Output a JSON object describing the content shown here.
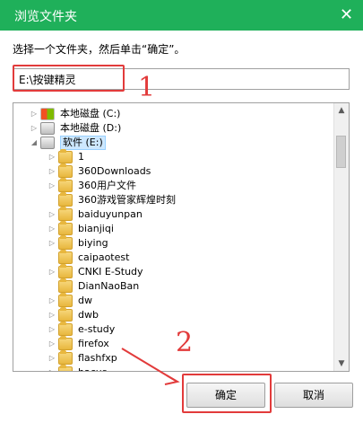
{
  "dialog": {
    "title": "浏览文件夹",
    "close_label": "✕"
  },
  "prompt": "选择一个文件夹，然后单击“确定”。",
  "path_input": {
    "value": "E:\\按键精灵"
  },
  "tree": {
    "items": [
      {
        "label": "本地磁盘 (C:)",
        "type": "drive-windows",
        "level": 0,
        "expand": "▷"
      },
      {
        "label": "本地磁盘 (D:)",
        "type": "drive",
        "level": 0,
        "expand": "▷"
      },
      {
        "label": "软件 (E:)",
        "type": "drive",
        "level": 0,
        "expand": "◢"
      },
      {
        "label": "1",
        "type": "folder",
        "level": 1,
        "expand": "▷"
      },
      {
        "label": "360Downloads",
        "type": "folder",
        "level": 1,
        "expand": "▷"
      },
      {
        "label": "360用户文件",
        "type": "folder",
        "level": 1,
        "expand": "▷"
      },
      {
        "label": "360游戏管家辉煌时刻",
        "type": "folder",
        "level": 1,
        "expand": ""
      },
      {
        "label": "baiduyunpan",
        "type": "folder",
        "level": 1,
        "expand": "▷"
      },
      {
        "label": "bianjiqi",
        "type": "folder",
        "level": 1,
        "expand": "▷"
      },
      {
        "label": "biying",
        "type": "folder",
        "level": 1,
        "expand": "▷"
      },
      {
        "label": "caipaotest",
        "type": "folder",
        "level": 1,
        "expand": ""
      },
      {
        "label": "CNKI E-Study",
        "type": "folder",
        "level": 1,
        "expand": "▷"
      },
      {
        "label": "DianNaoBan",
        "type": "folder",
        "level": 1,
        "expand": ""
      },
      {
        "label": "dw",
        "type": "folder",
        "level": 1,
        "expand": "▷"
      },
      {
        "label": "dwb",
        "type": "folder",
        "level": 1,
        "expand": "▷"
      },
      {
        "label": "e-study",
        "type": "folder",
        "level": 1,
        "expand": "▷"
      },
      {
        "label": "firefox",
        "type": "folder",
        "level": 1,
        "expand": "▷"
      },
      {
        "label": "flashfxp",
        "type": "folder",
        "level": 1,
        "expand": "▷"
      },
      {
        "label": "hacus",
        "type": "folder",
        "level": 1,
        "expand": "▷"
      }
    ],
    "selected_index": 2
  },
  "buttons": {
    "ok": "确定",
    "cancel": "取消"
  },
  "annotations": {
    "one": "1",
    "two": "2"
  },
  "colors": {
    "titlebar": "#1fb05a",
    "annotation": "#e23b3b",
    "selection": "#cde8ff"
  }
}
